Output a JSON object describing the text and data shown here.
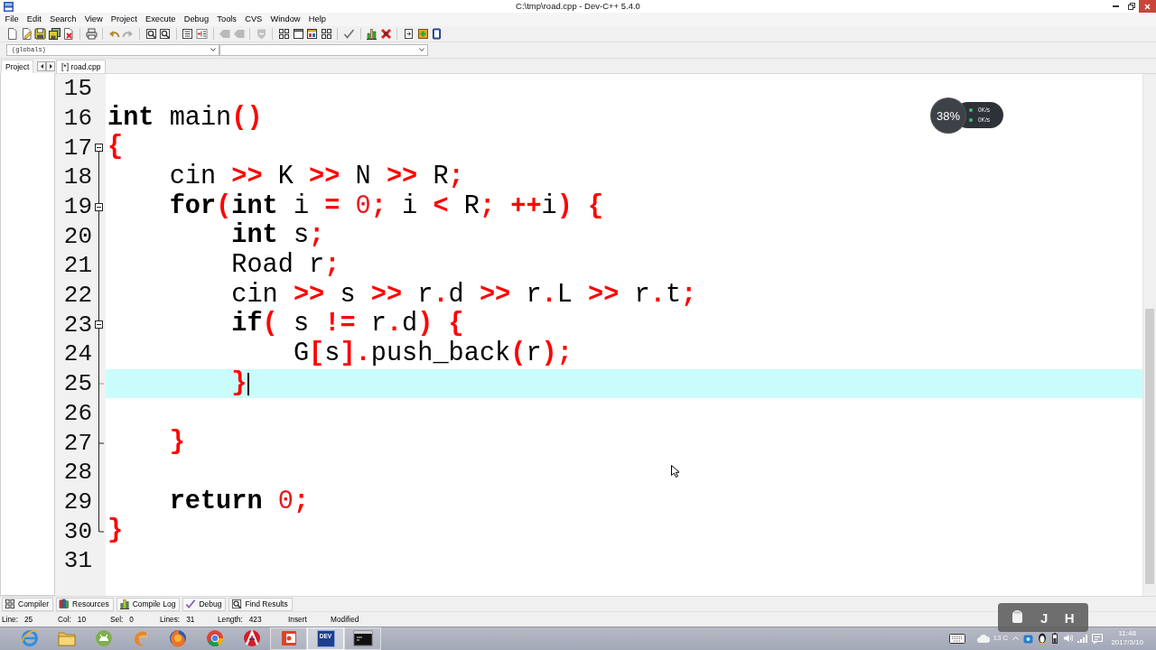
{
  "window": {
    "title": "C:\\tmp\\road.cpp - Dev-C++ 5.4.0"
  },
  "menu": [
    "File",
    "Edit",
    "Search",
    "View",
    "Project",
    "Execute",
    "Debug",
    "Tools",
    "CVS",
    "Window",
    "Help"
  ],
  "toolbar": [
    {
      "disabled": false
    },
    {
      "disabled": false
    },
    {
      "disabled": false
    },
    {
      "disabled": false
    },
    {
      "disabled": false
    },
    {
      "disabled": false
    },
    {
      "disabled": false
    },
    {
      "disabled": true
    },
    {
      "disabled": false
    },
    {
      "disabled": false
    },
    {
      "disabled": false
    },
    {
      "disabled": false
    },
    {
      "disabled": true
    },
    {
      "disabled": true
    },
    {
      "disabled": true
    },
    {
      "disabled": false
    },
    {
      "disabled": false
    },
    {
      "disabled": false
    },
    {
      "disabled": false
    },
    {
      "disabled": false
    },
    {
      "disabled": false
    },
    {
      "disabled": false
    },
    {
      "disabled": false
    },
    {
      "disabled": false
    },
    {
      "disabled": false
    }
  ],
  "scope_combo": {
    "value": "(globals)"
  },
  "left_panel": {
    "tab": "Project"
  },
  "editor_tabs": [
    {
      "label": "[*] road.cpp",
      "selected": true
    }
  ],
  "editor": {
    "lines": [
      {
        "number": "15",
        "fold_start": false,
        "fold_end": false,
        "current": false
      },
      {
        "number": "16",
        "fold_start": false,
        "fold_end": false,
        "current": false,
        "tokens": [
          {
            "kind": "keyword",
            "text": "int"
          },
          {
            "kind": "plain",
            "text": " main"
          },
          {
            "kind": "symbol",
            "text": "()"
          }
        ]
      },
      {
        "number": "17",
        "fold_start": true,
        "fold_end": false,
        "current": false,
        "tokens": [
          {
            "kind": "symbol",
            "text": "{"
          }
        ]
      },
      {
        "number": "18",
        "fold_start": false,
        "fold_end": false,
        "current": false,
        "tokens": [
          {
            "kind": "plain",
            "text": "    cin "
          },
          {
            "kind": "symbol",
            "text": ">>"
          },
          {
            "kind": "plain",
            "text": " K "
          },
          {
            "kind": "symbol",
            "text": ">>"
          },
          {
            "kind": "plain",
            "text": " N "
          },
          {
            "kind": "symbol",
            "text": ">>"
          },
          {
            "kind": "plain",
            "text": " R"
          },
          {
            "kind": "symbol",
            "text": ";"
          }
        ]
      },
      {
        "number": "19",
        "fold_start": true,
        "fold_end": false,
        "current": false,
        "tokens": [
          {
            "kind": "keyword",
            "text": "    for"
          },
          {
            "kind": "symbol",
            "text": "("
          },
          {
            "kind": "keyword",
            "text": "int"
          },
          {
            "kind": "plain",
            "text": " i "
          },
          {
            "kind": "symbol",
            "text": "="
          },
          {
            "kind": "number",
            "text": " 0"
          },
          {
            "kind": "symbol",
            "text": ";"
          },
          {
            "kind": "plain",
            "text": " i "
          },
          {
            "kind": "symbol",
            "text": "<"
          },
          {
            "kind": "plain",
            "text": " R"
          },
          {
            "kind": "symbol",
            "text": ";"
          },
          {
            "kind": "symbol",
            "text": " ++"
          },
          {
            "kind": "plain",
            "text": "i"
          },
          {
            "kind": "symbol",
            "text": ")"
          },
          {
            "kind": "symbol",
            "text": " {"
          }
        ]
      },
      {
        "number": "20",
        "fold_start": false,
        "fold_end": false,
        "current": false,
        "tokens": [
          {
            "kind": "keyword",
            "text": "        int"
          },
          {
            "kind": "plain",
            "text": " s"
          },
          {
            "kind": "symbol",
            "text": ";"
          }
        ]
      },
      {
        "number": "21",
        "fold_start": false,
        "fold_end": false,
        "current": false,
        "tokens": [
          {
            "kind": "plain",
            "text": "        Road r"
          },
          {
            "kind": "symbol",
            "text": ";"
          }
        ]
      },
      {
        "number": "22",
        "fold_start": false,
        "fold_end": false,
        "current": false,
        "tokens": [
          {
            "kind": "plain",
            "text": "        cin "
          },
          {
            "kind": "symbol",
            "text": ">>"
          },
          {
            "kind": "plain",
            "text": " s "
          },
          {
            "kind": "symbol",
            "text": ">>"
          },
          {
            "kind": "plain",
            "text": " r"
          },
          {
            "kind": "symbol",
            "text": "."
          },
          {
            "kind": "plain",
            "text": "d "
          },
          {
            "kind": "symbol",
            "text": ">>"
          },
          {
            "kind": "plain",
            "text": " r"
          },
          {
            "kind": "symbol",
            "text": "."
          },
          {
            "kind": "plain",
            "text": "L "
          },
          {
            "kind": "symbol",
            "text": ">>"
          },
          {
            "kind": "plain",
            "text": " r"
          },
          {
            "kind": "symbol",
            "text": "."
          },
          {
            "kind": "plain",
            "text": "t"
          },
          {
            "kind": "symbol",
            "text": ";"
          }
        ]
      },
      {
        "number": "23",
        "fold_start": true,
        "fold_end": false,
        "current": false,
        "tokens": [
          {
            "kind": "keyword",
            "text": "        if"
          },
          {
            "kind": "symbol",
            "text": "("
          },
          {
            "kind": "plain",
            "text": " s "
          },
          {
            "kind": "symbol",
            "text": "!="
          },
          {
            "kind": "plain",
            "text": " r"
          },
          {
            "kind": "symbol",
            "text": "."
          },
          {
            "kind": "plain",
            "text": "d"
          },
          {
            "kind": "symbol",
            "text": ")"
          },
          {
            "kind": "symbol",
            "text": " {"
          }
        ]
      },
      {
        "number": "24",
        "fold_start": false,
        "fold_end": false,
        "current": false,
        "tokens": [
          {
            "kind": "plain",
            "text": "            G"
          },
          {
            "kind": "symbol",
            "text": "["
          },
          {
            "kind": "plain",
            "text": "s"
          },
          {
            "kind": "symbol",
            "text": "]."
          },
          {
            "kind": "plain",
            "text": "push_back"
          },
          {
            "kind": "symbol",
            "text": "("
          },
          {
            "kind": "plain",
            "text": "r"
          },
          {
            "kind": "symbol",
            "text": ");"
          }
        ]
      },
      {
        "number": "25",
        "fold_start": false,
        "fold_end": true,
        "current": true,
        "tokens": [
          {
            "kind": "symbol",
            "text": "        }"
          }
        ]
      },
      {
        "number": "26",
        "fold_start": false,
        "fold_end": false,
        "current": false
      },
      {
        "number": "27",
        "fold_start": false,
        "fold_end": true,
        "current": false,
        "tokens": [
          {
            "kind": "symbol",
            "text": "    }"
          }
        ]
      },
      {
        "number": "28",
        "fold_start": false,
        "fold_end": false,
        "current": false
      },
      {
        "number": "29",
        "fold_start": false,
        "fold_end": false,
        "current": false,
        "tokens": [
          {
            "kind": "keyword",
            "text": "    return"
          },
          {
            "kind": "number",
            "text": " 0"
          },
          {
            "kind": "symbol",
            "text": ";"
          }
        ]
      },
      {
        "number": "30",
        "fold_start": false,
        "fold_end": true,
        "current": false,
        "tokens": [
          {
            "kind": "symbol",
            "text": "}"
          }
        ]
      },
      {
        "number": "31",
        "fold_start": false,
        "fold_end": false,
        "current": false
      }
    ]
  },
  "bottom_tabs": [
    "Compiler",
    "Resources",
    "Compile Log",
    "Debug",
    "Find Results"
  ],
  "status_bar": [
    {
      "label": "Line:",
      "value": "25"
    },
    {
      "label": "Col:",
      "value": "10"
    },
    {
      "label": "Sel:",
      "value": "0"
    },
    {
      "label": "Lines:",
      "value": "31"
    },
    {
      "label": "Length:",
      "value": "423"
    },
    {
      "value": "Insert"
    },
    {
      "value": "Modified"
    }
  ],
  "taskbar": {
    "apps": [
      {
        "running": false,
        "selected": false
      },
      {
        "running": false,
        "selected": false
      },
      {
        "running": false,
        "selected": false
      },
      {
        "running": false,
        "selected": false
      },
      {
        "running": false,
        "selected": false
      },
      {
        "running": false,
        "selected": false
      },
      {
        "running": false,
        "selected": false
      },
      {
        "running": true,
        "selected": false
      },
      {
        "running": true,
        "selected": true,
        "logo_text": "DEV"
      },
      {
        "running": true,
        "selected": false
      }
    ],
    "weather": "13 C",
    "time": "11:48",
    "date": "2017/3/10"
  },
  "speed_widget": {
    "percent": "38%",
    "rates": [
      "0K/s",
      "0K/s"
    ]
  },
  "ime_bar": {
    "keys": [
      "J",
      "H"
    ]
  }
}
